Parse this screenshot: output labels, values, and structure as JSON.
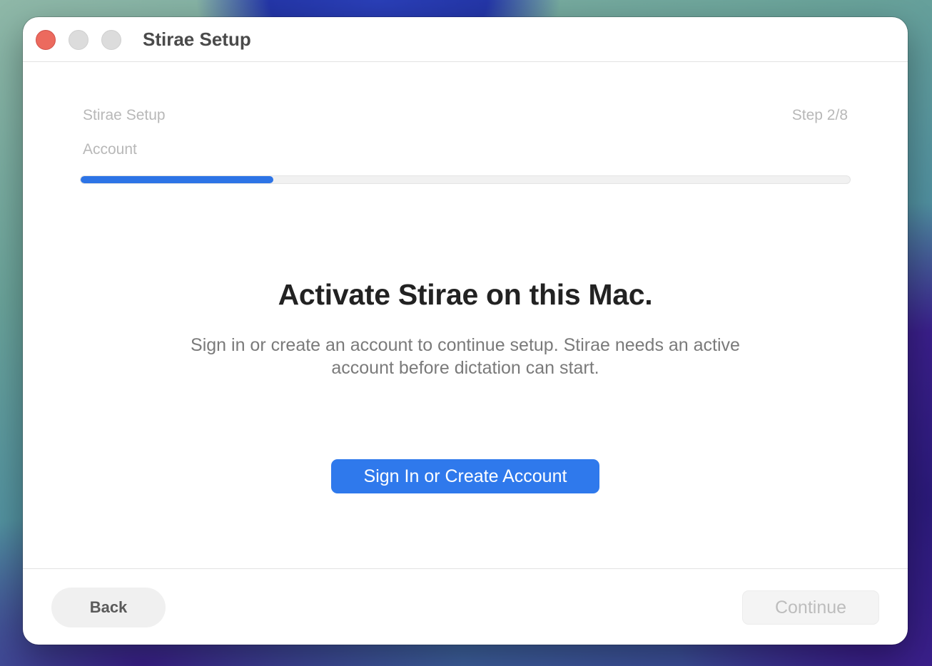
{
  "window": {
    "title": "Stirae Setup"
  },
  "header": {
    "section_title": "Stirae Setup",
    "step_label": "Step 2/8",
    "subsection": "Account",
    "progress": 0.25,
    "progress_color": "#2d74e6"
  },
  "main": {
    "heading": "Activate Stirae on this Mac.",
    "description": "Sign in or create an account to continue setup. Stirae needs an active account before dictation can start.",
    "primary_button": "Sign In or Create Account"
  },
  "footer": {
    "back_label": "Back",
    "continue_label": "Continue",
    "continue_enabled": false
  },
  "colors": {
    "accent": "#2f79ec",
    "close": "#ec6a5e"
  }
}
